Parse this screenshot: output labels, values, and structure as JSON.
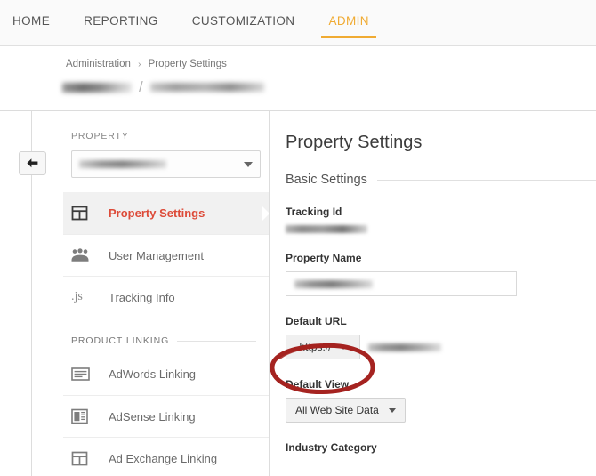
{
  "topnav": {
    "items": [
      {
        "label": "HOME",
        "active": false
      },
      {
        "label": "REPORTING",
        "active": false
      },
      {
        "label": "CUSTOMIZATION",
        "active": false
      },
      {
        "label": "ADMIN",
        "active": true
      }
    ],
    "active_color": "#f0ab33"
  },
  "breadcrumb": {
    "root": "Administration",
    "separator": "›",
    "current": "Property Settings",
    "account_name_redacted": true,
    "property_name_redacted": true,
    "slash": "/"
  },
  "rail": {
    "back_button_icon": "back-arrow-icon"
  },
  "sidebar": {
    "group_label": "PROPERTY",
    "property_selector": {
      "value_redacted": true,
      "caret_icon": "chevron-down-icon"
    },
    "items": [
      {
        "label": "Property Settings",
        "icon": "property-icon",
        "active": true
      },
      {
        "label": "User Management",
        "icon": "people-icon",
        "active": false
      },
      {
        "label": "Tracking Info",
        "icon": "js-icon",
        "active": false
      }
    ],
    "section_label": "PRODUCT LINKING",
    "linking_items": [
      {
        "label": "AdWords Linking",
        "icon": "adwords-icon"
      },
      {
        "label": "AdSense Linking",
        "icon": "adsense-icon"
      },
      {
        "label": "Ad Exchange Linking",
        "icon": "adexchange-icon"
      }
    ],
    "active_color": "#dd4b39"
  },
  "main": {
    "title": "Property Settings",
    "section_title": "Basic Settings",
    "fields": {
      "tracking_id": {
        "label": "Tracking Id",
        "value_redacted": true
      },
      "property_name": {
        "label": "Property Name",
        "value_redacted": true
      },
      "default_url": {
        "label": "Default URL",
        "protocol": "https://",
        "protocol_caret_icon": "chevron-down-icon",
        "value_redacted": true
      },
      "default_view": {
        "label": "Default View",
        "value": "All Web Site Data",
        "caret_icon": "chevron-down-icon"
      },
      "industry_category": {
        "label": "Industry Category"
      }
    }
  },
  "annotation": {
    "shape": "hand-drawn-ellipse",
    "color": "#a52320",
    "target": "https-protocol-dropdown"
  }
}
